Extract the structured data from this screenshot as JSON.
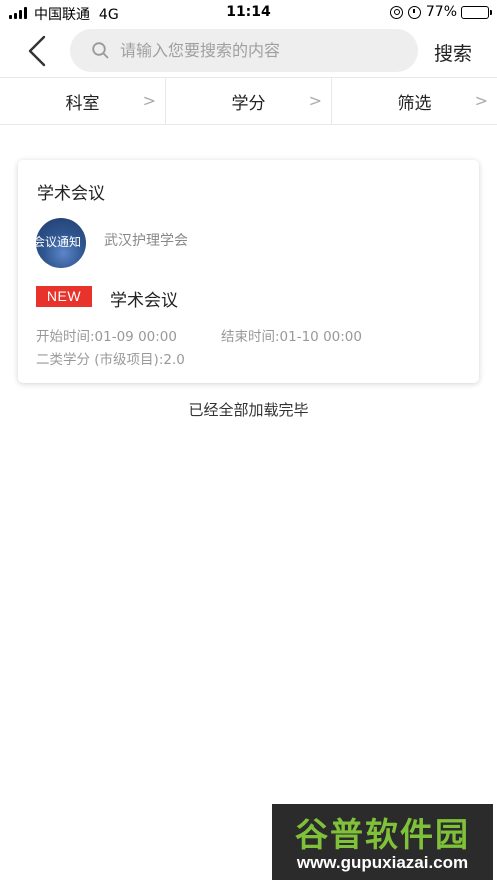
{
  "status_bar": {
    "carrier": "中国联通",
    "network": "4G",
    "time": "11:14",
    "battery": "77%",
    "battery_level": 0.77,
    "icons": [
      "signal-icon",
      "lock-rotation-icon",
      "alarm-icon",
      "battery-icon"
    ]
  },
  "nav": {
    "back_icon": "chevron-left-icon",
    "search_placeholder": "请输入您要搜索的内容",
    "search_value": "",
    "search_button": "搜索"
  },
  "filters": [
    {
      "label": "科室",
      "arrow": ">"
    },
    {
      "label": "学分",
      "arrow": ">"
    },
    {
      "label": "筛选",
      "arrow": ">"
    }
  ],
  "card": {
    "title": "学术会议",
    "avatar_text": "会议通知",
    "org": "武汉护理学会",
    "badge": "NEW",
    "event_title": "学术会议",
    "start_time": "开始时间:01-09 00:00",
    "end_time": "结束时间:01-10 00:00",
    "credit": "二类学分 (市级项目):2.0"
  },
  "footer": {
    "load_complete": "已经全部加载完毕"
  },
  "watermark": {
    "logo": "谷普软件园",
    "url": "www.gupuxiazai.com"
  },
  "colors": {
    "badge": "#e8322c",
    "search_bg": "#eeeeee",
    "watermark_green": "#7fc23a"
  }
}
